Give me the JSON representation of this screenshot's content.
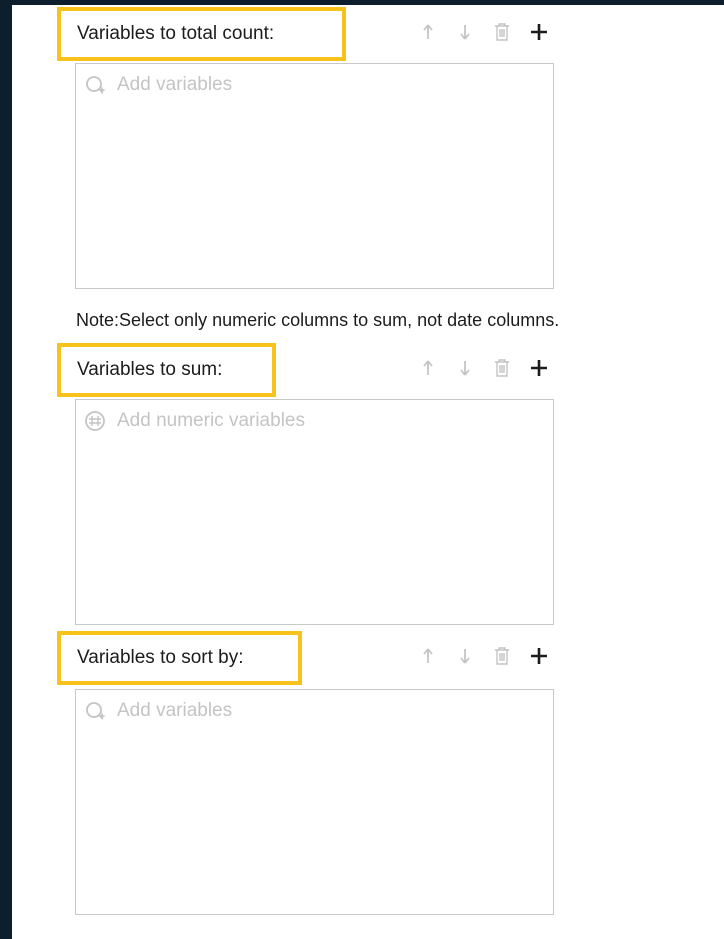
{
  "sections": [
    {
      "label": "Variables to total count:",
      "placeholder": "Add variables",
      "placeholder_icon": "variable-search-icon"
    },
    {
      "label": "Variables to sum:",
      "placeholder": "Add numeric variables",
      "placeholder_icon": "numeric-variable-icon"
    },
    {
      "label": "Variables to sort by:",
      "placeholder": "Add variables",
      "placeholder_icon": "variable-search-icon"
    }
  ],
  "note": "Note:Select only numeric columns to sum, not date columns.",
  "toolbar_icons": [
    "arrow-up-icon",
    "arrow-down-icon",
    "trash-icon",
    "plus-icon"
  ],
  "colors": {
    "highlight": "#f7c21b",
    "background_dark": "#0d1f2d",
    "disabled_icon": "#c4c4c4",
    "active_icon": "#1c1c1c"
  }
}
